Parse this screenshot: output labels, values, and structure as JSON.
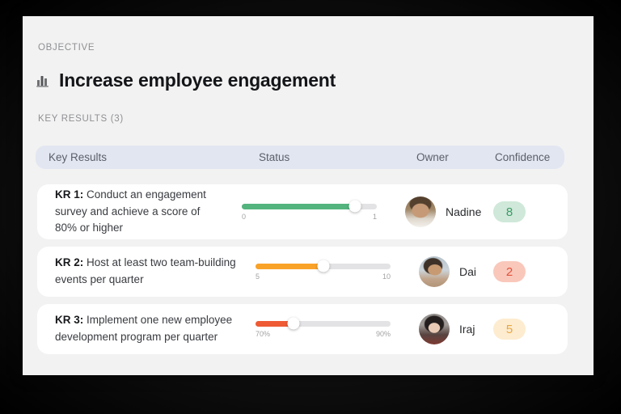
{
  "page": {
    "objective_label": "OBJECTIVE",
    "objective_title": "Increase employee engagement",
    "title_icon": "bar-chart-icon",
    "key_results_label": "KEY RESULTS (3)"
  },
  "colors": {
    "frame": "#0b0b0b",
    "panel_bg": "#f2f2f2",
    "header_bg": "#e2e6f1",
    "card_bg": "#ffffff",
    "slider_track": "#e3e3e5"
  },
  "table": {
    "headers": [
      "Key Results",
      "Status",
      "Owner",
      "Confidence"
    ]
  },
  "key_results": [
    {
      "kr_label": "KR 1:",
      "description": "Conduct an engagement survey and achieve a score of 80% or higher",
      "slider": {
        "min_label": "0",
        "max_label": "1",
        "fill_percent": 84,
        "color": "#53b47e"
      },
      "owner": "Nadine",
      "confidence": {
        "value": "8",
        "bg": "#cfe8d9",
        "color": "#3c9b68"
      }
    },
    {
      "kr_label": "KR 2:",
      "description": "Host at least two team-building events per quarter",
      "slider": {
        "min_label": "5",
        "max_label": "10",
        "fill_percent": 50,
        "color": "#f9a228"
      },
      "owner": "Dai",
      "confidence": {
        "value": "2",
        "bg": "#f9c8bb",
        "color": "#e2523a"
      }
    },
    {
      "kr_label": "KR 3:",
      "description": "Implement one new employee development program per quarter",
      "slider": {
        "min_label": "70%",
        "max_label": "90%",
        "fill_percent": 28,
        "color": "#ee5b35"
      },
      "owner": "Iraj",
      "confidence": {
        "value": "5",
        "bg": "#fdeccf",
        "color": "#e8a845"
      }
    }
  ]
}
